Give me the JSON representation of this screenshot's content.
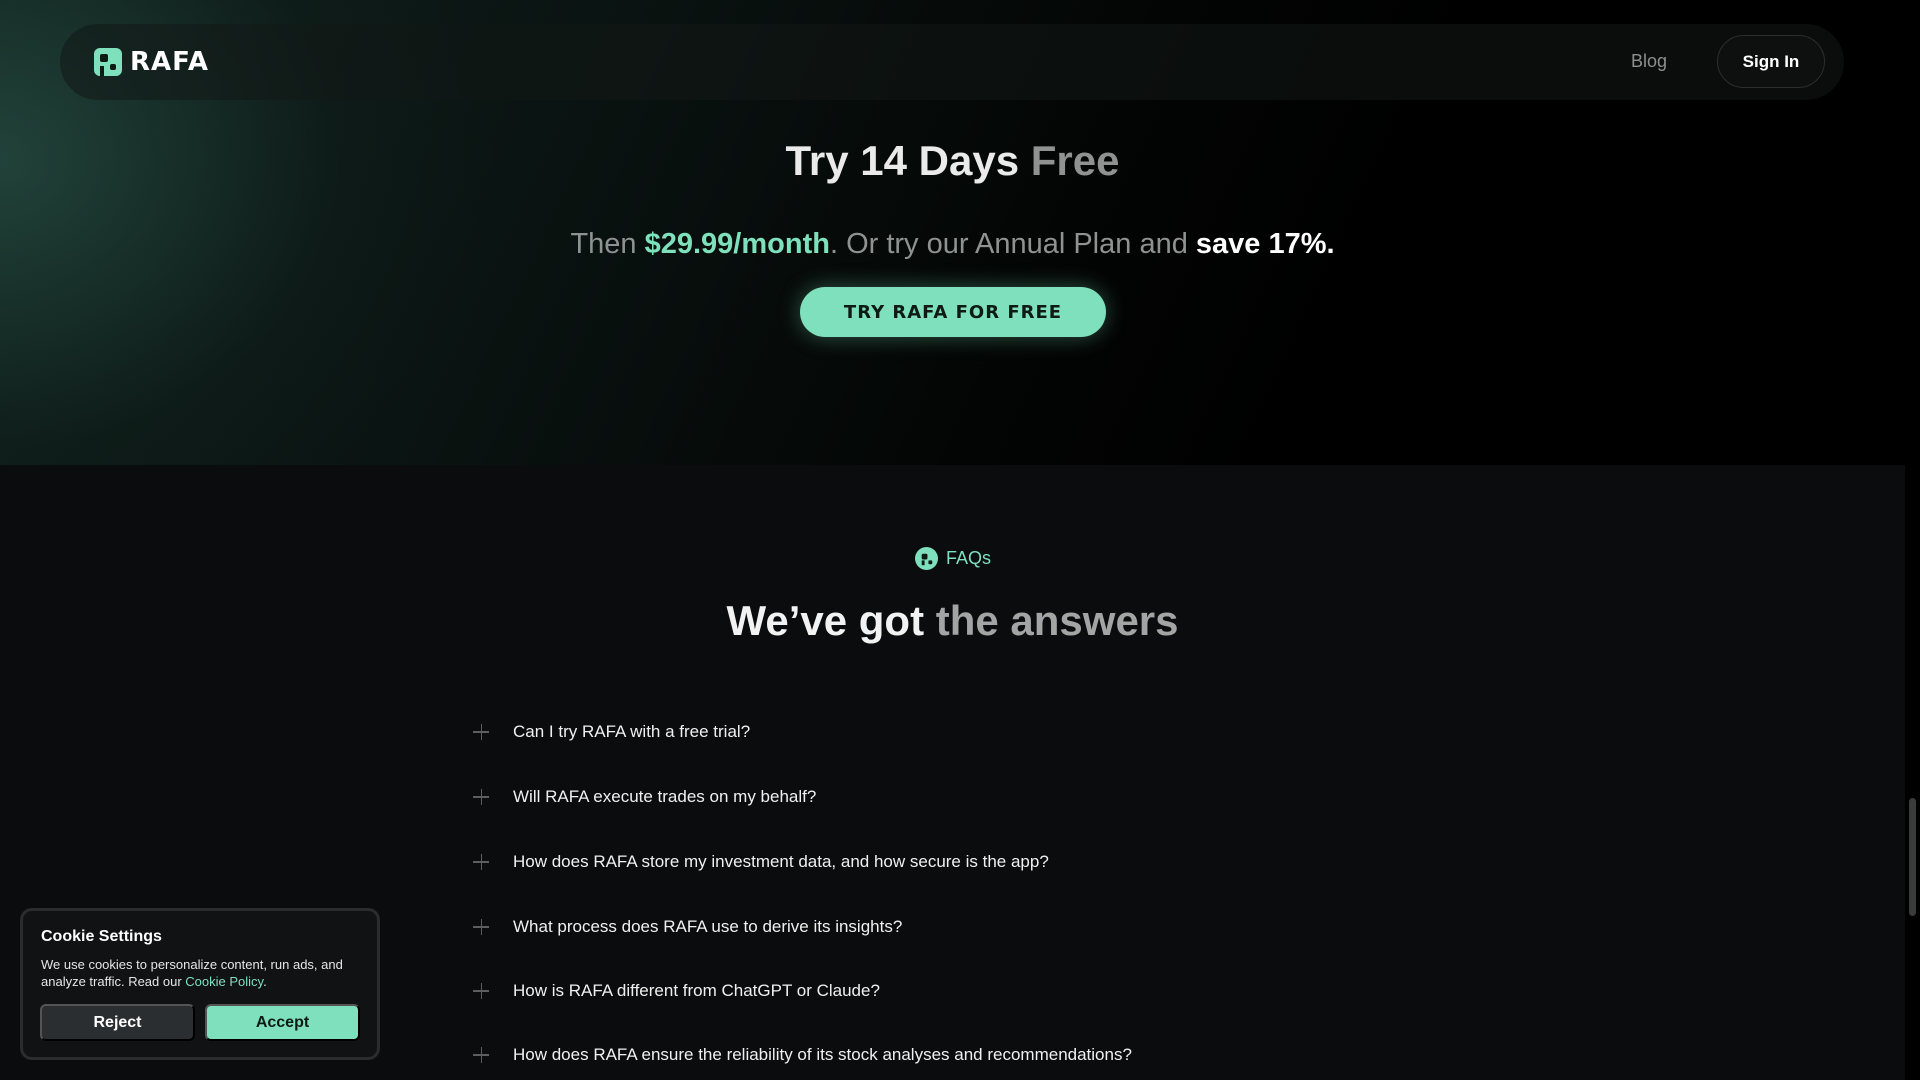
{
  "header": {
    "logo_text": "RAFA",
    "nav": {
      "blog_label": "Blog",
      "signin_label": "Sign In"
    }
  },
  "hero": {
    "title_part1": "Try 14 Days",
    "title_part2": " Free",
    "sub_prefix": "Then ",
    "sub_price": "$29.99/month",
    "sub_middle": ". Or try our Annual Plan and ",
    "sub_save": "save 17%.",
    "cta_label": "TRY RAFA FOR FREE"
  },
  "faq": {
    "tag_label": "FAQs",
    "title_part1": "We’ve got",
    "title_part2": " the answers",
    "items": [
      {
        "question": "Can I try RAFA with a free trial?"
      },
      {
        "question": "Will RAFA execute trades on my behalf?"
      },
      {
        "question": "How does RAFA store my investment data, and how secure is the app?"
      },
      {
        "question": " What process does RAFA use to derive its insights?"
      },
      {
        "question": "How is RAFA different from ChatGPT or Claude?"
      },
      {
        "question": "How does RAFA ensure the reliability of its stock analyses and recommendations?"
      }
    ]
  },
  "cookie": {
    "title": "Cookie Settings",
    "body_text": "We use cookies to personalize content, run ads, and analyze traffic. Read our ",
    "link_text": "Cookie Policy",
    "body_suffix": ".",
    "reject_label": "Reject",
    "accept_label": "Accept"
  },
  "colors": {
    "accent": "#7ee0bd",
    "background": "#000000",
    "section_background": "#0b0c0d"
  },
  "icons": [
    "rafa-logo-icon",
    "plus-icon"
  ]
}
